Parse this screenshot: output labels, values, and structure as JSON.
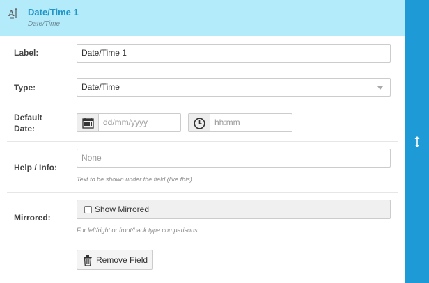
{
  "header": {
    "title": "Date/Time 1",
    "subtitle": "Date/Time",
    "icon": "text-field-icon"
  },
  "form": {
    "label_field": {
      "label": "Label:",
      "value": "Date/Time 1"
    },
    "type_field": {
      "label": "Type:",
      "value": "Date/Time",
      "icon": "chevron-down-icon"
    },
    "default_date": {
      "label_line1": "Default",
      "label_line2": "Date:",
      "date_placeholder": "dd/mm/yyyy",
      "time_placeholder": "hh:mm",
      "date_icon": "calendar-icon",
      "time_icon": "clock-icon"
    },
    "help_info": {
      "label": "Help / Info:",
      "placeholder": "None",
      "help_text": "Text to be shown under the field (like this)."
    },
    "mirrored": {
      "label": "Mirrored:",
      "checkbox_label": "Show Mirrored",
      "checked": false,
      "help_text": "For left/right or front/back type comparisons."
    },
    "remove_button": {
      "label": "Remove Field",
      "icon": "trash-icon"
    }
  },
  "sidebar": {
    "icon": "vertical-resize-icon"
  },
  "colors": {
    "header_bg": "#b3ebfb",
    "accent": "#2196c6",
    "sidebar_bg": "#1e9bd6"
  }
}
